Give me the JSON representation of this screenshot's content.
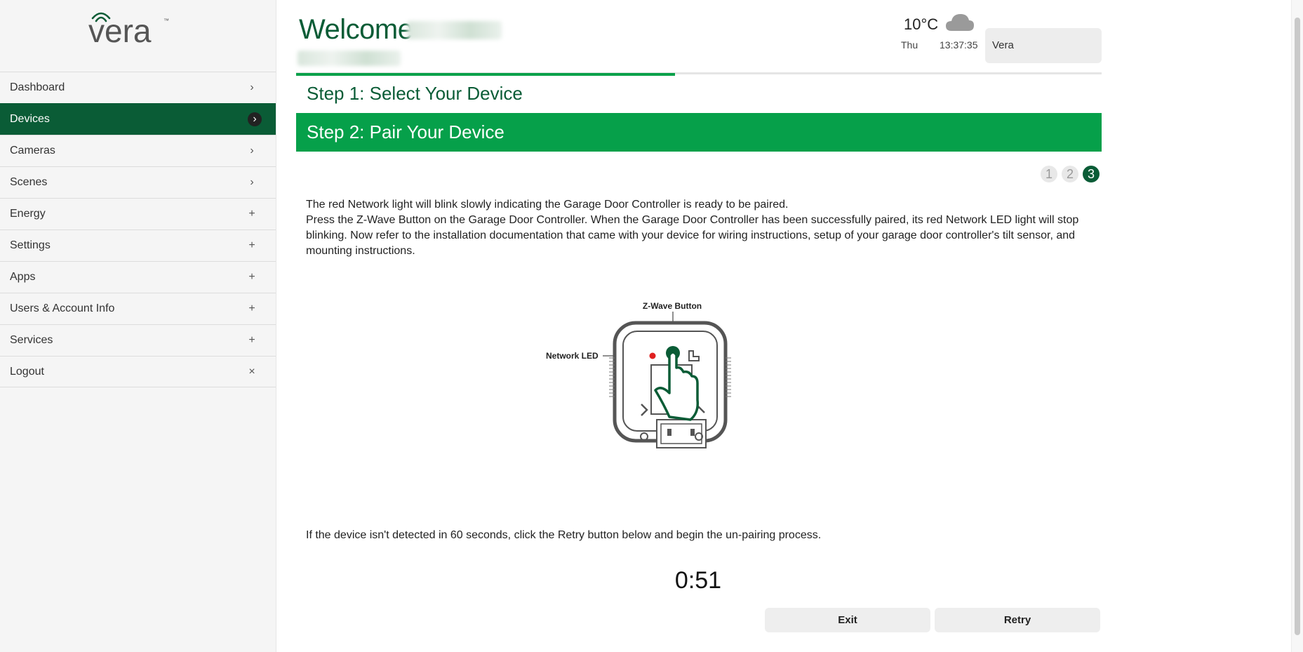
{
  "brand": {
    "logo_text": "vera",
    "trademark": "™"
  },
  "nav": [
    {
      "label": "Dashboard",
      "icon": "chevron-right-icon",
      "glyph": "›",
      "active": false
    },
    {
      "label": "Devices",
      "icon": "chevron-right-icon",
      "glyph": "›",
      "active": true
    },
    {
      "label": "Cameras",
      "icon": "chevron-right-icon",
      "glyph": "›",
      "active": false
    },
    {
      "label": "Scenes",
      "icon": "chevron-right-icon",
      "glyph": "›",
      "active": false
    },
    {
      "label": "Energy",
      "icon": "plus-icon",
      "glyph": "+",
      "active": false
    },
    {
      "label": "Settings",
      "icon": "plus-icon",
      "glyph": "+",
      "active": false
    },
    {
      "label": "Apps",
      "icon": "plus-icon",
      "glyph": "+",
      "active": false
    },
    {
      "label": "Users & Account Info",
      "icon": "plus-icon",
      "glyph": "+",
      "active": false
    },
    {
      "label": "Services",
      "icon": "plus-icon",
      "glyph": "+",
      "active": false
    },
    {
      "label": "Logout",
      "icon": "close-icon",
      "glyph": "×",
      "active": false
    }
  ],
  "header": {
    "welcome": "Welcome",
    "weather": {
      "temp": "10°C",
      "day": "Thu",
      "time": "13:37:35",
      "icon": "cloud-icon"
    },
    "account": "Vera"
  },
  "wizard": {
    "step1": "Step 1: Select Your Device",
    "step2": "Step 2: Pair Your Device",
    "progress": 0.47,
    "pages": [
      "1",
      "2",
      "3"
    ],
    "current_page": 3,
    "instruction_1": "The red Network light will blink slowly indicating the Garage Door Controller is ready to be paired.",
    "instruction_2": "Press the Z-Wave Button on the Garage Door Controller. When the Garage Door Controller has been successfully paired, its red Network LED light will stop blinking. Now refer to the installation documentation that came with your device for wiring instructions, setup of your garage door controller's tilt sensor, and mounting instructions.",
    "illustration": {
      "zwave_label": "Z-Wave Button",
      "led_label": "Network LED"
    },
    "retry_note": "If the device isn't detected in 60 seconds, click the Retry button below and begin the un-pairing process.",
    "countdown": "0:51",
    "exit_label": "Exit",
    "retry_label": "Retry"
  },
  "colors": {
    "brand_green": "#0a5c36",
    "accent_green": "#06a04a",
    "led_red": "#e02020"
  }
}
